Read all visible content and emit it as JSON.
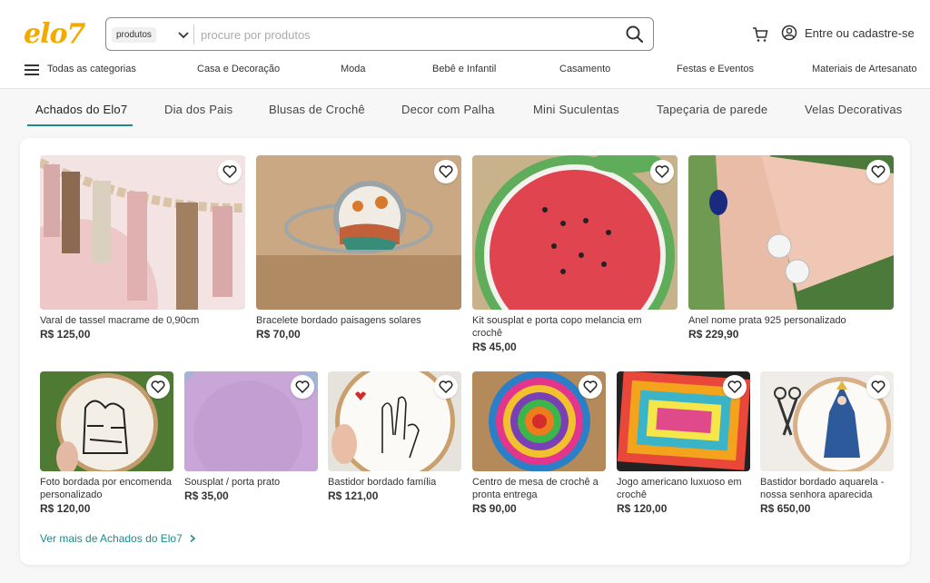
{
  "header": {
    "logo": "elo7",
    "search": {
      "category": "produtos",
      "placeholder": "procure por produtos"
    },
    "user_link": "Entre ou cadastre-se"
  },
  "categories": {
    "all": "Todas as categorias",
    "items": [
      "Casa e Decoração",
      "Moda",
      "Bebê e Infantil",
      "Casamento",
      "Festas e Eventos",
      "Materiais de Artesanato"
    ]
  },
  "tabs": [
    "Achados do Elo7",
    "Dia dos Pais",
    "Blusas de Crochê",
    "Decor com Palha",
    "Mini Suculentas",
    "Tapeçaria de parede",
    "Velas Decorativas"
  ],
  "products_row1": [
    {
      "title": "Varal de tassel macrame de 0,90cm",
      "price": "R$ 125,00"
    },
    {
      "title": "Bracelete bordado paisagens solares",
      "price": "R$ 70,00"
    },
    {
      "title": "Kit sousplat e porta copo melancia em crochê",
      "price": "R$ 45,00"
    },
    {
      "title": "Anel nome prata 925 personalizado",
      "price": "R$ 229,90"
    }
  ],
  "products_row2": [
    {
      "title": "Foto bordada por encomenda personalizado",
      "price": "R$ 120,00"
    },
    {
      "title": "Sousplat / porta prato",
      "price": "R$ 35,00"
    },
    {
      "title": "Bastidor bordado família",
      "price": "R$ 121,00"
    },
    {
      "title": "Centro de mesa de crochê a pronta entrega",
      "price": "R$ 90,00"
    },
    {
      "title": "Jogo americano luxuoso em crochê",
      "price": "R$ 120,00"
    },
    {
      "title": "Bastidor bordado aquarela - nossa senhora aparecida",
      "price": "R$ 650,00"
    }
  ],
  "see_more": "Ver mais de Achados do Elo7",
  "colors": {
    "brand": "#f2a900",
    "accent": "#1b8b8b"
  }
}
